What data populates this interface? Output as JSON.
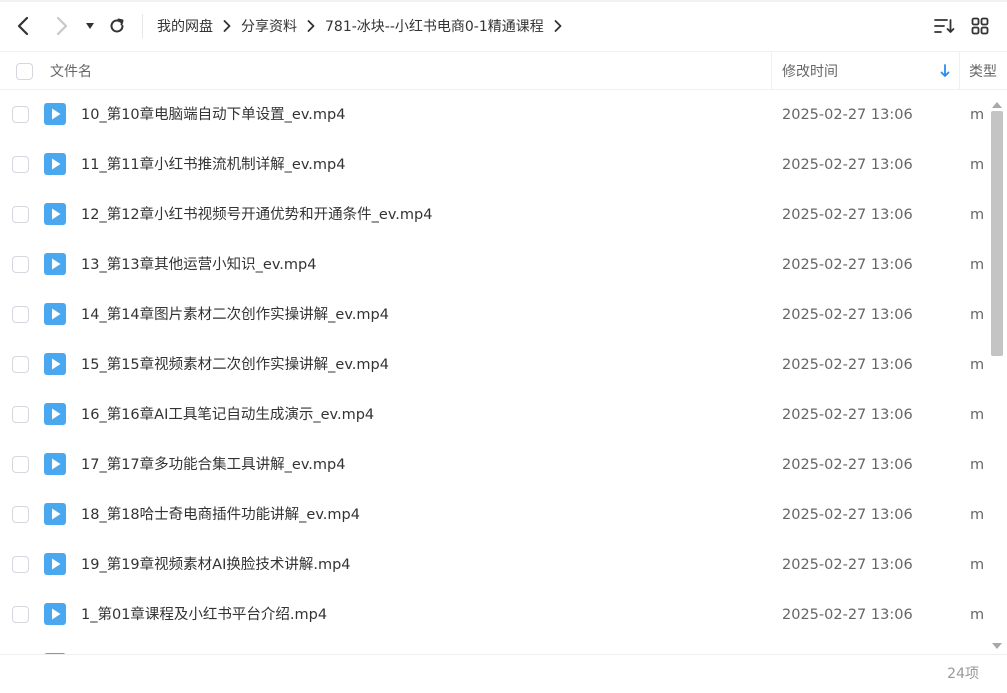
{
  "toolbar": {
    "breadcrumb": [
      "我的网盘",
      "分享资料",
      "781-冰块--小红书电商0-1精通课程"
    ]
  },
  "header": {
    "name": "文件名",
    "modified": "修改时间",
    "type": "类型"
  },
  "files": [
    {
      "name": "10_第10章电脑端自动下单设置_ev.mp4",
      "time": "2025-02-27 13:06",
      "type": "m"
    },
    {
      "name": "11_第11章小红书推流机制详解_ev.mp4",
      "time": "2025-02-27 13:06",
      "type": "m"
    },
    {
      "name": "12_第12章小红书视频号开通优势和开通条件_ev.mp4",
      "time": "2025-02-27 13:06",
      "type": "m"
    },
    {
      "name": "13_第13章其他运营小知识_ev.mp4",
      "time": "2025-02-27 13:06",
      "type": "m"
    },
    {
      "name": "14_第14章图片素材二次创作实操讲解_ev.mp4",
      "time": "2025-02-27 13:06",
      "type": "m"
    },
    {
      "name": "15_第15章视频素材二次创作实操讲解_ev.mp4",
      "time": "2025-02-27 13:06",
      "type": "m"
    },
    {
      "name": "16_第16章AI工具笔记自动生成演示_ev.mp4",
      "time": "2025-02-27 13:06",
      "type": "m"
    },
    {
      "name": "17_第17章多功能合集工具讲解_ev.mp4",
      "time": "2025-02-27 13:06",
      "type": "m"
    },
    {
      "name": "18_第18哈士奇电商插件功能讲解_ev.mp4",
      "time": "2025-02-27 13:06",
      "type": "m"
    },
    {
      "name": "19_第19章视频素材AI换脸技术讲解.mp4",
      "time": "2025-02-27 13:06",
      "type": "m"
    },
    {
      "name": "1_第01章课程及小红书平台介绍.mp4",
      "time": "2025-02-27 13:06",
      "type": "m"
    }
  ],
  "footer": {
    "count": "24项"
  },
  "colors": {
    "video_icon": "#4aa8f0",
    "sort_arrow": "#2a8cf0"
  }
}
